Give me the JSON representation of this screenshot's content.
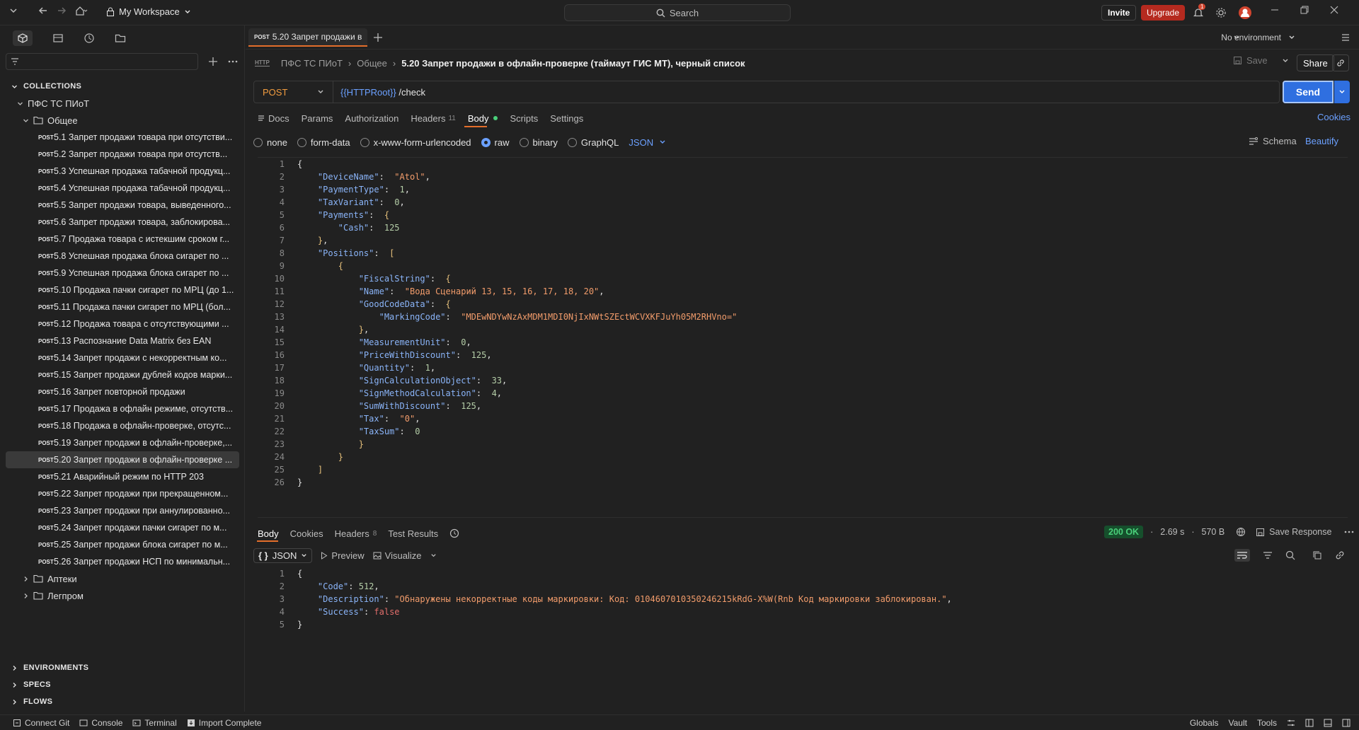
{
  "titlebar": {
    "workspace": "My Workspace",
    "search_placeholder": "Search",
    "invite": "Invite",
    "upgrade": "Upgrade",
    "notification_count": "1"
  },
  "sidebar": {
    "collections_label": "COLLECTIONS",
    "collection_name": "ПФС ТС ПИоТ",
    "folder_name": "Общее",
    "requests": [
      {
        "method": "POST",
        "name": "5.1 Запрет продажи товара при отсутстви..."
      },
      {
        "method": "POST",
        "name": "5.2 Запрет продажи товара при отсутств..."
      },
      {
        "method": "POST",
        "name": "5.3 Успешная продажа табачной продукц..."
      },
      {
        "method": "POST",
        "name": "5.4 Успешная продажа табачной продукц..."
      },
      {
        "method": "POST",
        "name": "5.5 Запрет продажи товара, выведенного..."
      },
      {
        "method": "POST",
        "name": "5.6 Запрет продажи товара, заблокирова..."
      },
      {
        "method": "POST",
        "name": "5.7 Продажа товара с истекшим сроком г..."
      },
      {
        "method": "POST",
        "name": "5.8 Успешная продажа блока сигарет по ..."
      },
      {
        "method": "POST",
        "name": "5.9 Успешная продажа блока сигарет по ..."
      },
      {
        "method": "POST",
        "name": "5.10 Продажа пачки сигарет по МРЦ (до 1..."
      },
      {
        "method": "POST",
        "name": "5.11 Продажа пачки сигарет по МРЦ (бол..."
      },
      {
        "method": "POST",
        "name": "5.12 Продажа товара с отсутствующими ..."
      },
      {
        "method": "POST",
        "name": "5.13 Распознание Data Matrix без EAN"
      },
      {
        "method": "POST",
        "name": "5.14 Запрет продажи с некорректным ко..."
      },
      {
        "method": "POST",
        "name": "5.15 Запрет продажи дублей кодов марки..."
      },
      {
        "method": "POST",
        "name": "5.16 Запрет повторной продажи"
      },
      {
        "method": "POST",
        "name": "5.17 Продажа в офлайн режиме, отсутств..."
      },
      {
        "method": "POST",
        "name": "5.18 Продажа в офлайн-проверке, отсутс..."
      },
      {
        "method": "POST",
        "name": "5.19 Запрет продажи в офлайн-проверке,..."
      },
      {
        "method": "POST",
        "name": "5.20 Запрет продажи в офлайн-проверке ..."
      },
      {
        "method": "POST",
        "name": "5.21 Аварийный режим по HTTP 203"
      },
      {
        "method": "POST",
        "name": "5.22 Запрет продажи при прекращенном..."
      },
      {
        "method": "POST",
        "name": "5.23 Запрет продажи при аннулированно..."
      },
      {
        "method": "POST",
        "name": "5.24 Запрет продажи пачки сигарет по м..."
      },
      {
        "method": "POST",
        "name": "5.25 Запрет продажи блока сигарет по м..."
      },
      {
        "method": "POST",
        "name": "5.26 Запрет продажи НСП по минимальн..."
      }
    ],
    "other_folders": [
      "Аптеки",
      "Легпром"
    ],
    "bottom_sections": [
      "ENVIRONMENTS",
      "SPECS",
      "FLOWS"
    ]
  },
  "tab": {
    "method": "POST",
    "label": "5.20 Запрет продажи в"
  },
  "environment": "No environment",
  "breadcrumb": {
    "collection": "ПФС ТС ПИоТ",
    "folder": "Общее",
    "current": "5.20 Запрет продажи в офлайн-проверке (таймаут ГИС МТ), черный список"
  },
  "actions": {
    "save": "Save",
    "share": "Share",
    "send": "Send"
  },
  "request": {
    "method": "POST",
    "url_var": "{{HTTPRoot}}",
    "url_path": " /check"
  },
  "request_tabs": {
    "docs": "Docs",
    "params": "Params",
    "authorization": "Authorization",
    "headers": "Headers",
    "headers_count": "11",
    "body": "Body",
    "scripts": "Scripts",
    "settings": "Settings",
    "cookies": "Cookies"
  },
  "body_types": {
    "none": "none",
    "form_data": "form-data",
    "urlencoded": "x-www-form-urlencoded",
    "raw": "raw",
    "binary": "binary",
    "graphql": "GraphQL",
    "format": "JSON",
    "schema": "Schema",
    "beautify": "Beautify"
  },
  "request_body": [
    {
      "n": "1",
      "html": "{"
    },
    {
      "n": "2",
      "html": "    <span class='k'>\"DeviceName\"</span>:  <span class='s'>\"Atol\"</span>,"
    },
    {
      "n": "3",
      "html": "    <span class='k'>\"PaymentType\"</span>:  <span class='n'>1</span>,"
    },
    {
      "n": "4",
      "html": "    <span class='k'>\"TaxVariant\"</span>:  <span class='n'>0</span>,"
    },
    {
      "n": "5",
      "html": "    <span class='k'>\"Payments\"</span>:  <span class='p'>{</span>"
    },
    {
      "n": "6",
      "html": "        <span class='k'>\"Cash\"</span>:  <span class='n'>125</span>"
    },
    {
      "n": "7",
      "html": "    <span class='p'>}</span>,"
    },
    {
      "n": "8",
      "html": "    <span class='k'>\"Positions\"</span>:  <span class='p'>[</span>"
    },
    {
      "n": "9",
      "html": "        <span class='p'>{</span>"
    },
    {
      "n": "10",
      "html": "            <span class='k'>\"FiscalString\"</span>:  <span class='p'>{</span>"
    },
    {
      "n": "11",
      "html": "            <span class='k'>\"Name\"</span>:  <span class='s'>\"Вода Сценарий 13, 15, 16, 17, 18, 20\"</span>,"
    },
    {
      "n": "12",
      "html": "            <span class='k'>\"GoodCodeData\"</span>:  <span class='p'>{</span>"
    },
    {
      "n": "13",
      "html": "                <span class='k'>\"MarkingCode\"</span>:  <span class='s'>\"MDEwNDYwNzAxMDM1MDI0NjIxNWtSZEctWCVXKFJuYh05M2RHVno=\"</span>"
    },
    {
      "n": "14",
      "html": "            <span class='p'>}</span>,"
    },
    {
      "n": "15",
      "html": "            <span class='k'>\"MeasurementUnit\"</span>:  <span class='n'>0</span>,"
    },
    {
      "n": "16",
      "html": "            <span class='k'>\"PriceWithDiscount\"</span>:  <span class='n'>125</span>,"
    },
    {
      "n": "17",
      "html": "            <span class='k'>\"Quantity\"</span>:  <span class='n'>1</span>,"
    },
    {
      "n": "18",
      "html": "            <span class='k'>\"SignCalculationObject\"</span>:  <span class='n'>33</span>,"
    },
    {
      "n": "19",
      "html": "            <span class='k'>\"SignMethodCalculation\"</span>:  <span class='n'>4</span>,"
    },
    {
      "n": "20",
      "html": "            <span class='k'>\"SumWithDiscount\"</span>:  <span class='n'>125</span>,"
    },
    {
      "n": "21",
      "html": "            <span class='k'>\"Tax\"</span>:  <span class='s'>\"0\"</span>,"
    },
    {
      "n": "22",
      "html": "            <span class='k'>\"TaxSum\"</span>:  <span class='n'>0</span>"
    },
    {
      "n": "23",
      "html": "            <span class='p'>}</span>"
    },
    {
      "n": "24",
      "html": "        <span class='p'>}</span>"
    },
    {
      "n": "25",
      "html": "    <span class='p'>]</span>"
    },
    {
      "n": "26",
      "html": "}"
    }
  ],
  "response_tabs": {
    "body": "Body",
    "cookies": "Cookies",
    "headers": "Headers",
    "headers_count": "8",
    "test_results": "Test Results"
  },
  "response_status": {
    "code": "200 OK",
    "time": "2.69 s",
    "size": "570 B",
    "save": "Save Response"
  },
  "response_view": {
    "format": "JSON",
    "preview": "Preview",
    "visualize": "Visualize"
  },
  "response_body": [
    {
      "n": "1",
      "html": "{"
    },
    {
      "n": "2",
      "html": "    <span class='rk'>\"Code\"</span>: <span class='rn'>512</span>,"
    },
    {
      "n": "3",
      "html": "    <span class='rk'>\"Description\"</span>: <span class='rs'>\"Обнаружены некорректные коды маркировки: Код: 0104607010350246215kRdG-X%W(Rnb Код маркировки заблокирован.\"</span>,"
    },
    {
      "n": "4",
      "html": "    <span class='rk'>\"Success\"</span>: <span class='rb'>false</span>"
    },
    {
      "n": "5",
      "html": "}"
    }
  ],
  "statusbar": {
    "connect_git": "Connect Git",
    "console": "Console",
    "terminal": "Terminal",
    "import": "Import Complete",
    "globals": "Globals",
    "vault": "Vault",
    "tools": "Tools"
  },
  "colors": {
    "accent": "#e36e2b",
    "send": "#2f6fe0",
    "upgrade": "#b52a1f",
    "ok": "#4ad07a"
  }
}
